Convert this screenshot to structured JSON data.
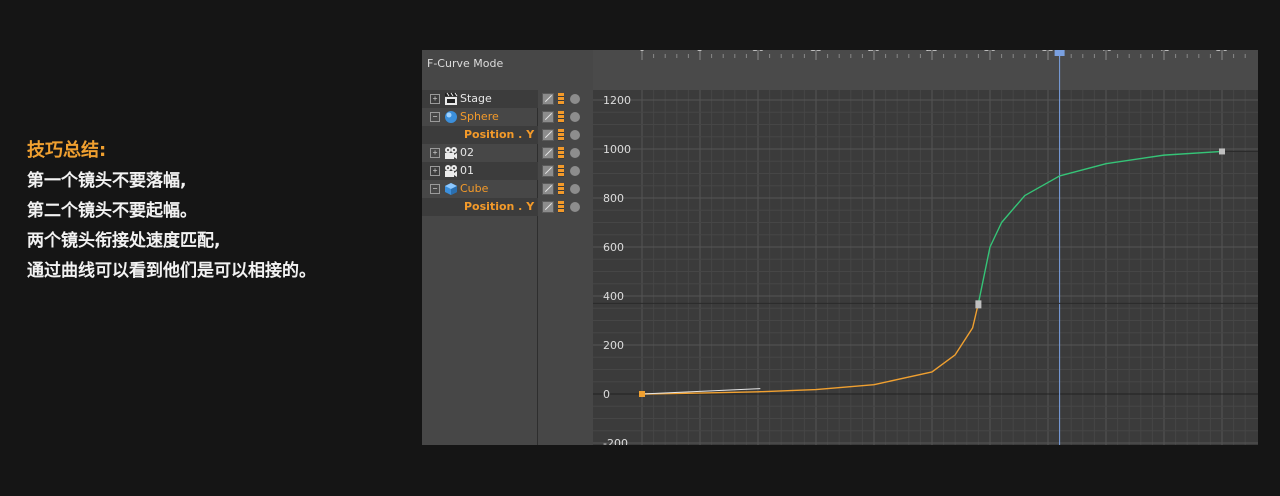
{
  "notes": {
    "title": "技巧总结:",
    "lines": [
      "第一个镜头不要落幅,",
      "第二个镜头不要起幅。",
      "两个镜头衔接处速度匹配,",
      "通过曲线可以看到他们是可以相接的。"
    ]
  },
  "editor": {
    "mode_label": "F-Curve Mode",
    "tree": [
      {
        "label": "Stage",
        "icon": "clapperboard-icon",
        "expander": "+",
        "color": "normal"
      },
      {
        "label": "Sphere",
        "icon": "sphere-icon",
        "expander": "−",
        "color": "orange"
      },
      {
        "label": "Position . Y",
        "icon": "",
        "expander": "",
        "color": "track"
      },
      {
        "label": "02",
        "icon": "camera-icon",
        "expander": "+",
        "color": "normal"
      },
      {
        "label": "01",
        "icon": "camera-icon",
        "expander": "+",
        "color": "normal"
      },
      {
        "label": "Cube",
        "icon": "cube-icon",
        "expander": "−",
        "color": "orange"
      },
      {
        "label": "Position . Y",
        "icon": "",
        "expander": "",
        "color": "track"
      }
    ],
    "timeline": {
      "frame_ticks": [
        "0",
        "5",
        "10",
        "15",
        "20",
        "25",
        "30",
        "35",
        "40",
        "45",
        "50"
      ],
      "current_frame": 36
    }
  },
  "chart_data": {
    "type": "line",
    "title": "",
    "xlabel": "",
    "ylabel": "",
    "yticks": [
      1200,
      1000,
      800,
      600,
      400,
      200,
      0,
      -200
    ],
    "xlim": [
      0,
      52
    ],
    "ylim": [
      -200,
      1200
    ],
    "series": [
      {
        "color": "#f0a030",
        "points": [
          [
            0,
            0
          ],
          [
            5,
            4
          ],
          [
            10,
            9
          ],
          [
            15,
            18
          ],
          [
            20,
            38
          ],
          [
            25,
            90
          ],
          [
            27,
            160
          ],
          [
            28.5,
            270
          ],
          [
            29,
            370
          ]
        ]
      },
      {
        "color": "#35c477",
        "points": [
          [
            29,
            370
          ],
          [
            30,
            600
          ],
          [
            31,
            700
          ],
          [
            33,
            810
          ],
          [
            36,
            890
          ],
          [
            40,
            940
          ],
          [
            45,
            975
          ],
          [
            50,
            990
          ]
        ]
      }
    ],
    "keyframes": [
      [
        0,
        0
      ],
      [
        29,
        370
      ],
      [
        50,
        990
      ]
    ],
    "colors": {
      "orange_curve": "#f0a030",
      "green_curve": "#35c477",
      "playhead": "#7aa0e0"
    }
  }
}
